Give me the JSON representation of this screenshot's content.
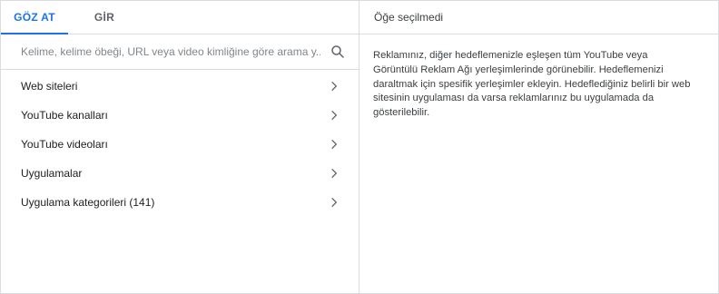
{
  "tabs": [
    {
      "label": "GÖZ AT",
      "active": true
    },
    {
      "label": "GİR",
      "active": false
    }
  ],
  "search": {
    "placeholder": "Kelime, kelime öbeği, URL veya video kimliğine göre arama y...",
    "icon": "search-icon"
  },
  "categories": [
    {
      "label": "Web siteleri"
    },
    {
      "label": "YouTube kanalları"
    },
    {
      "label": "YouTube videoları"
    },
    {
      "label": "Uygulamalar"
    },
    {
      "label": "Uygulama kategorileri (141)"
    }
  ],
  "selection": {
    "header": "Öğe seçilmedi",
    "description": "Reklamınız, diğer hedeflemenizle eşleşen tüm YouTube veya Görüntülü Reklam Ağı yerleşimlerinde görünebilir. Hedeflemenizi daraltmak için spesifik yerleşimler ekleyin. Hedeflediğiniz belirli bir web sitesinin uygulaması da varsa reklamlarınız bu uygulamada da gösterilebilir."
  },
  "colors": {
    "accent": "#1a73e8",
    "border": "#dadce0",
    "text": "#202124",
    "muted": "#5f6368"
  }
}
